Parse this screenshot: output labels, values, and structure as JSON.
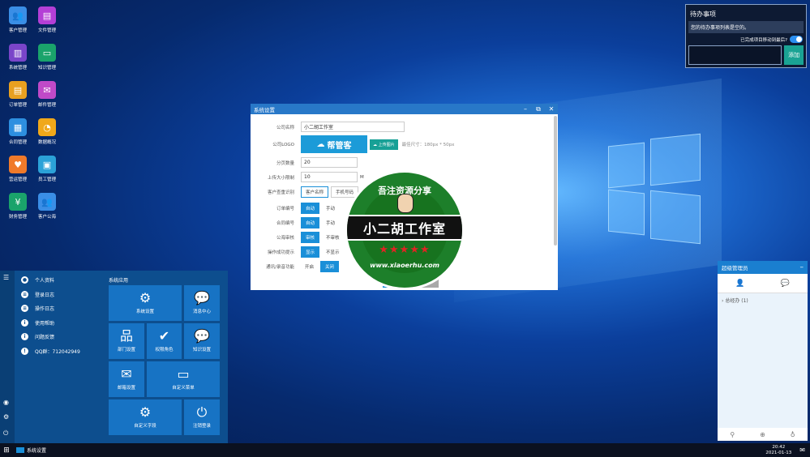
{
  "desktop": {
    "icons": [
      {
        "label": "客户管理",
        "icon": "users-icon",
        "color": "#3a8ee6"
      },
      {
        "label": "文件管理",
        "icon": "file-icon",
        "color": "#b43fd6"
      },
      {
        "label": "系统管理",
        "icon": "book-icon",
        "color": "#7a45c9"
      },
      {
        "label": "知识管理",
        "icon": "chat-icon",
        "color": "#1aa36b"
      },
      {
        "label": "订单管理",
        "icon": "order-icon",
        "color": "#e8a020"
      },
      {
        "label": "邮件管理",
        "icon": "mail-icon",
        "color": "#c04ac8"
      },
      {
        "label": "合同管理",
        "icon": "contract-icon",
        "color": "#2d8fe0"
      },
      {
        "label": "数据概况",
        "icon": "pie-icon",
        "color": "#f0a81a"
      },
      {
        "label": "营运管理",
        "icon": "heart-icon",
        "color": "#f07a2a"
      },
      {
        "label": "员工管理",
        "icon": "badge-icon",
        "color": "#2ba2d8"
      },
      {
        "label": "财务管理",
        "icon": "money-icon",
        "color": "#1aa36b"
      },
      {
        "label": "客户公海",
        "icon": "users-icon",
        "color": "#3a8ee6"
      }
    ]
  },
  "todo": {
    "title": "待办事项",
    "empty_text": "您的待办事项列表是空的。",
    "auto_move_label": "已完成项目移动到最后?",
    "add_label": "添加"
  },
  "dialog": {
    "title": "系统设置",
    "fields": {
      "company_name_label": "公司名称",
      "company_name_value": "小二胡工作室",
      "logo_label": "公司LOGO",
      "logo_text": "帮管客",
      "upload_label": "上传图片",
      "logo_hint": "最佳尺寸：180px * 50px",
      "page_size_label": "分页数量",
      "page_size_value": "20",
      "upload_limit_label": "上传大小限制",
      "upload_limit_value": "10",
      "upload_limit_unit": "M",
      "dedup_label": "客户查重识别",
      "dedup_opt1": "客户名称",
      "dedup_opt2": "手机号码",
      "order_no_label": "订单编号",
      "contract_no_label": "合同编号",
      "auto_label": "自动",
      "manual_label": "手动",
      "sea_review_label": "公海审核",
      "review_label": "审核",
      "no_review_label": "不审核",
      "success_tip_label": "操作成功提示",
      "show_label": "显示",
      "hide_label": "不显示",
      "sound_label": "通讯/录音功能",
      "on_label": "开启",
      "off_label": "关闭"
    },
    "save_label": "保存",
    "close_label": "关闭"
  },
  "watermark": {
    "top_text": "吾注资源分享",
    "main_text": "小二胡工作室",
    "url_text": "www.xiaoerhu.com",
    "stars": "★★★★★"
  },
  "start_menu": {
    "items": [
      {
        "label": "个人资料",
        "icon": "user-icon"
      },
      {
        "label": "登录日志",
        "icon": "list-icon"
      },
      {
        "label": "操作日志",
        "icon": "list-icon"
      },
      {
        "label": "使用帮助",
        "icon": "info-icon"
      },
      {
        "label": "问题反馈",
        "icon": "info-icon"
      },
      {
        "label": "QQ群：712042949",
        "icon": "alert-icon"
      }
    ],
    "group_label": "系统应用",
    "tiles": [
      {
        "label": "系统设置",
        "glyph": "⚙"
      },
      {
        "label": "消息中心",
        "glyph": "💬"
      },
      {
        "label": "部门设置",
        "glyph": "品"
      },
      {
        "label": "权限角色",
        "glyph": "✔"
      },
      {
        "label": "知识设置",
        "glyph": "💬"
      },
      {
        "label": "邮箱设置",
        "glyph": "✉"
      },
      {
        "label": "自定义菜单",
        "glyph": "▭"
      },
      {
        "label": "自定义字段",
        "glyph": "⚙"
      },
      {
        "label": "注销登录",
        "glyph": "⏻"
      }
    ]
  },
  "admin_panel": {
    "title": "超级管理员",
    "group": "总经办",
    "group_count": "(1)"
  },
  "taskbar": {
    "app_label": "系统设置",
    "time": "20:42",
    "date": "2021-01-13"
  }
}
